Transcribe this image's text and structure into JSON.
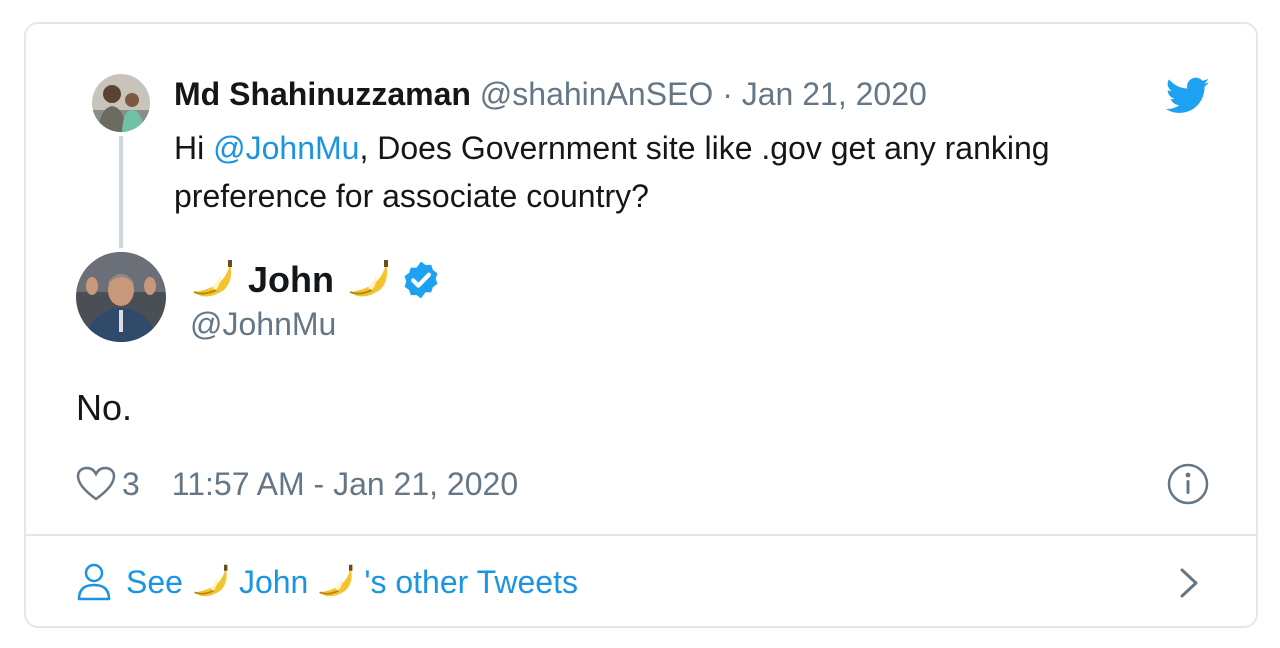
{
  "parent_tweet": {
    "name": "Md Shahinuzzaman",
    "handle": "@shahinAnSEO",
    "separator": "·",
    "date": "Jan 21, 2020",
    "text_prefix": "Hi ",
    "mention": "@JohnMu",
    "text_suffix": ", Does Government site like .gov get any ranking preference for associate country?",
    "avatar_icon": "profile-photo"
  },
  "main_tweet": {
    "name": "John",
    "handle": "@JohnMu",
    "verified": true,
    "name_emoji": "banana",
    "text": "No.",
    "likes": "3",
    "timestamp": "11:57 AM - Jan 21, 2020"
  },
  "footer": {
    "see_label": "See",
    "name": "John",
    "suffix": "'s other Tweets"
  },
  "icons": {
    "brand": "twitter-bird-icon",
    "like": "heart-icon",
    "info": "info-icon",
    "person": "person-icon",
    "chevron": "chevron-right-icon"
  },
  "colors": {
    "accent": "#1da1f2",
    "link": "#1b95e0",
    "muted": "#657786",
    "border": "#e1e8ed",
    "thread_line": "#ccd6dd"
  }
}
